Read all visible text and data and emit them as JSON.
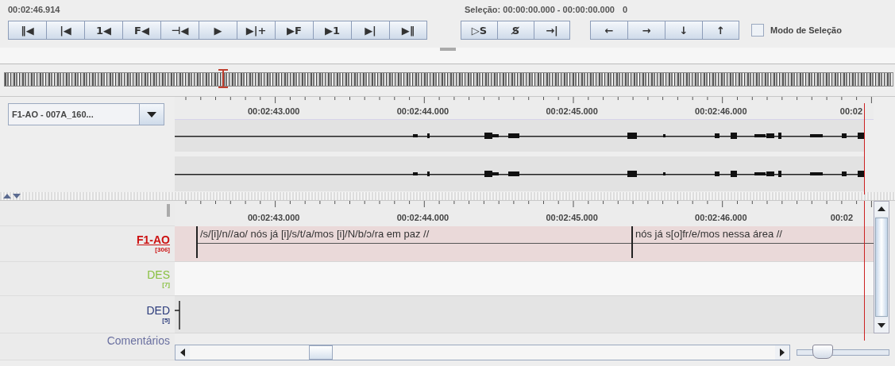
{
  "time_display": "00:02:46.914",
  "selection": {
    "range": "Seleção: 00:00:00.000 - 00:00:00.000",
    "length": "0"
  },
  "playback_buttons": [
    {
      "label": "‖◀"
    },
    {
      "label": "|◀"
    },
    {
      "label": "1◀"
    },
    {
      "label": "F◀"
    },
    {
      "label": "⊣◀"
    },
    {
      "label": "▶"
    },
    {
      "label": "▶|+"
    },
    {
      "label": "▶F"
    },
    {
      "label": "▶1"
    },
    {
      "label": "▶|"
    },
    {
      "label": "▶‖"
    }
  ],
  "selection_buttons": [
    {
      "label": "▷S"
    },
    {
      "label": "S̸"
    },
    {
      "label": "→|"
    }
  ],
  "navigation_buttons": [
    {
      "label": "←"
    },
    {
      "label": "→"
    },
    {
      "label": "↓"
    },
    {
      "label": "↑"
    }
  ],
  "selection_mode": {
    "label": "Modo de Seleção",
    "checked": false
  },
  "waveform_panel": {
    "media": "F1-AO - 007A_160...",
    "ruler": [
      "00:02:43.000",
      "00:02:44.000",
      "00:02:45.000",
      "00:02:46.000",
      "00:02"
    ]
  },
  "annotation_panel": {
    "ruler": [
      "00:02:43.000",
      "00:02:44.000",
      "00:02:45.000",
      "00:02:46.000",
      "00:02"
    ],
    "tiers": [
      {
        "name": "F1-AO",
        "count": "[306]",
        "color": "#cc1111",
        "selected": true,
        "boundary": false,
        "annotations": [
          "/s/[i]/n//ao/ nós já [i]/s/t/a/mos [i]/N/b/ɔ/ra em paz //",
          "nós já s[o]fr/e/mos nessa área //"
        ]
      },
      {
        "name": "DES",
        "count": "[7]",
        "color": "#88c040",
        "selected": false,
        "boundary": false
      },
      {
        "name": "DED",
        "count": "[5]",
        "color": "#2a3a7a",
        "selected": false,
        "boundary": true
      },
      {
        "name": "Comentários",
        "color": "#6a70a0",
        "selected": false
      }
    ]
  },
  "zoom_slider": {
    "level": 0.28
  }
}
